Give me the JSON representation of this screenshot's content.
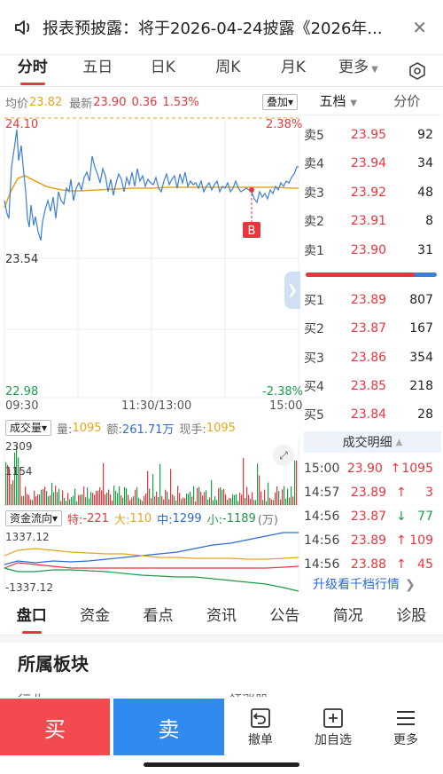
{
  "banner": {
    "text": "报表预披露：将于2026-04-24披露《2026年...",
    "speaker_icon": "speaker-icon",
    "close_icon": "close-icon"
  },
  "tabs": [
    {
      "label": "分时",
      "active": true
    },
    {
      "label": "五日"
    },
    {
      "label": "日K"
    },
    {
      "label": "周K"
    },
    {
      "label": "月K"
    },
    {
      "label": "更多"
    }
  ],
  "settings_icon": "hexagon-settings-icon",
  "chart_header": {
    "avg_label": "均价",
    "avg_value": "23.82",
    "latest_label": "最新",
    "latest_value": "23.90",
    "change": "0.36",
    "change_pct": "1.53%",
    "overlay_button": "叠加"
  },
  "price_axis": {
    "high": "24.10",
    "mid": "23.54",
    "low": "22.98",
    "high_pct": "2.38%",
    "low_pct": "-2.38%"
  },
  "time_axis": [
    "09:30",
    "11:30/13:00",
    "15:00"
  ],
  "marker_label": "B",
  "volume_header": {
    "dropdown": "成交量",
    "volume_label": "量:",
    "volume_value": "1095",
    "amount_label": "额:",
    "amount_value": "261.71万",
    "current_label": "现手:",
    "current_value": "1095",
    "vol_top": "2309",
    "vol_mid": "1154"
  },
  "capital_header": {
    "dropdown": "资金流向",
    "special_label": "特:",
    "special_value": "-221",
    "large_label": "大:",
    "large_value": "110",
    "medium_label": "中:",
    "medium_value": "1299",
    "small_label": "小:",
    "small_value": "-1189",
    "unit": "(万)",
    "top": "1337.12",
    "bottom": "-1337.12"
  },
  "orderbook_tabs": {
    "five": "五档",
    "tick": "分价"
  },
  "orderbook": {
    "asks": [
      {
        "label": "卖5",
        "price": "23.95",
        "vol": "92"
      },
      {
        "label": "卖4",
        "price": "23.94",
        "vol": "34"
      },
      {
        "label": "卖3",
        "price": "23.92",
        "vol": "48"
      },
      {
        "label": "卖2",
        "price": "23.91",
        "vol": "8"
      },
      {
        "label": "卖1",
        "price": "23.90",
        "vol": "31"
      }
    ],
    "bids": [
      {
        "label": "买1",
        "price": "23.89",
        "vol": "807"
      },
      {
        "label": "买2",
        "price": "23.87",
        "vol": "167"
      },
      {
        "label": "买3",
        "price": "23.86",
        "vol": "354"
      },
      {
        "label": "买4",
        "price": "23.85",
        "vol": "218"
      },
      {
        "label": "买5",
        "price": "23.84",
        "vol": "28"
      }
    ],
    "buy_ratio": 0.83
  },
  "trades_header": "成交明细",
  "trades": [
    {
      "time": "15:00",
      "price": "23.90",
      "arrow": "↑",
      "vol": "1095",
      "dir": "up"
    },
    {
      "time": "14:57",
      "price": "23.89",
      "arrow": "↑",
      "vol": "3",
      "dir": "up"
    },
    {
      "time": "14:56",
      "price": "23.87",
      "arrow": "↓",
      "vol": "77",
      "dir": "down"
    },
    {
      "time": "14:56",
      "price": "23.89",
      "arrow": "↑",
      "vol": "109",
      "dir": "up"
    },
    {
      "time": "14:56",
      "price": "23.88",
      "arrow": "↑",
      "vol": "45",
      "dir": "up"
    }
  ],
  "upgrade_link": "升级看千档行情",
  "bottom_tabs": [
    {
      "label": "盘口",
      "active": true
    },
    {
      "label": "资金"
    },
    {
      "label": "看点"
    },
    {
      "label": "资讯"
    },
    {
      "label": "公告"
    },
    {
      "label": "简况"
    },
    {
      "label": "诊股"
    }
  ],
  "section_title": "所属板块",
  "section_partial_left": "行业",
  "section_partial_right": "领涨股",
  "bottom_bar": {
    "buy": "买",
    "sell": "卖",
    "cancel": "撤单",
    "add_watch": "加自选",
    "more": "更多"
  },
  "colors": {
    "up": "#e8363c",
    "down": "#1a9c4a",
    "avg_line": "#e6a520",
    "price_line": "#3b7fd6",
    "buy_button": "#f24a4f",
    "sell_button": "#2f8bf0"
  }
}
